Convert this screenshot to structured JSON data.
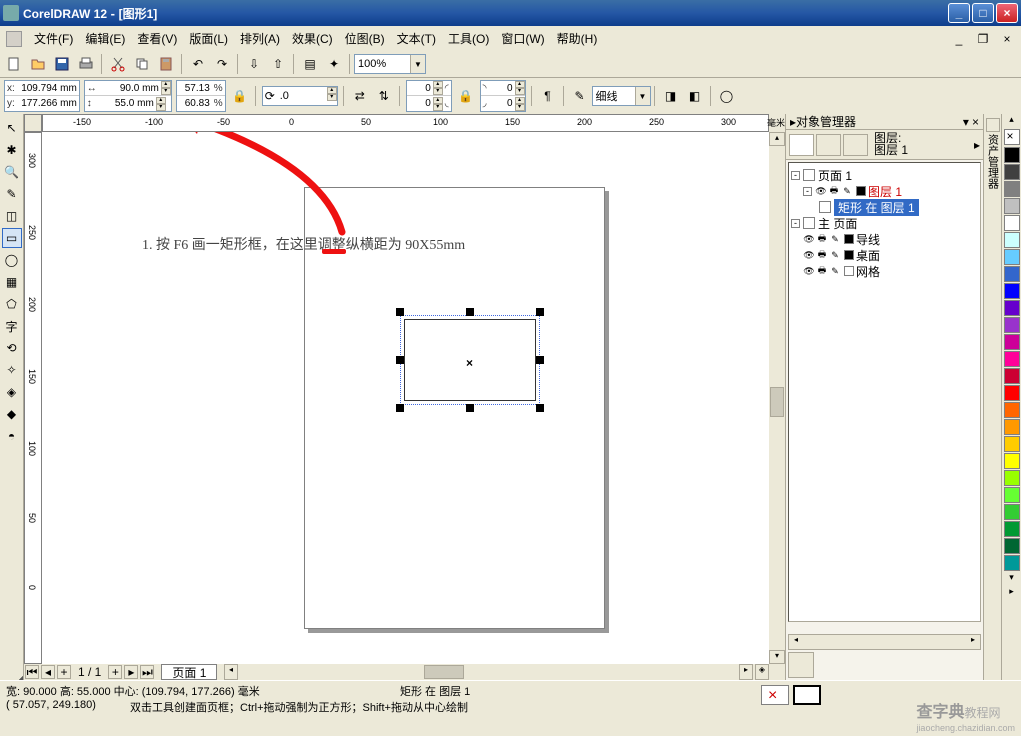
{
  "titlebar": {
    "app": "CorelDRAW 12",
    "doc": "[图形1]"
  },
  "menu": {
    "file": "文件(F)",
    "edit": "编辑(E)",
    "view": "查看(V)",
    "layout": "版面(L)",
    "arrange": "排列(A)",
    "effects": "效果(C)",
    "bitmaps": "位图(B)",
    "text": "文本(T)",
    "tools": "工具(O)",
    "window": "窗口(W)",
    "help": "帮助(H)"
  },
  "toolbar": {
    "zoom": "100%"
  },
  "properties": {
    "x": "109.794 mm",
    "y": "177.266 mm",
    "w": "90.0 mm",
    "h": "55.0 mm",
    "sx": "57.13",
    "sy": "60.83",
    "rot": ".0",
    "cornerTL": "0",
    "cornerTR": "0",
    "cornerBL": "0",
    "cornerBR": "0",
    "outline": "细线"
  },
  "ruler": {
    "unit": "毫米"
  },
  "annotation": {
    "text": "1. 按 F6 画一矩形框，在这里调整纵横距为 90X55mm"
  },
  "pagenav": {
    "counter": "1 / 1",
    "tab": "页面 1"
  },
  "docker": {
    "title": "对象管理器",
    "layer_lbl": "图层:",
    "layer_name": "图层 1",
    "tree": {
      "page": "页面 1",
      "layer1": "图层 1",
      "rect": "矩形 在 图层 1",
      "master": "主 页面",
      "guides": "导线",
      "desktop": "桌面",
      "grid": "网格"
    }
  },
  "status": {
    "dims": "宽: 90.000 高: 55.000 中心: (109.794, 177.266) 毫米",
    "coords": "( 57.057, 249.180)",
    "hint": "双击工具创建面页框；Ctrl+拖动强制为正方形；Shift+拖动从中心绘制",
    "info": "矩形 在 图层 1"
  },
  "watermark": {
    "brand": "查字典",
    "suffix": "教程网",
    "url": "jiaocheng.chazidian.com"
  },
  "colors": [
    "#000000",
    "#404040",
    "#808080",
    "#c0c0c0",
    "#ffffff",
    "#ccffff",
    "#66ccff",
    "#3366cc",
    "#0000ff",
    "#6600cc",
    "#9933cc",
    "#cc0099",
    "#ff0099",
    "#cc0033",
    "#ff0000",
    "#ff6600",
    "#ff9900",
    "#ffcc00",
    "#ffff00",
    "#99ff00",
    "#66ff33",
    "#33cc33",
    "#009933",
    "#006633",
    "#009999"
  ]
}
